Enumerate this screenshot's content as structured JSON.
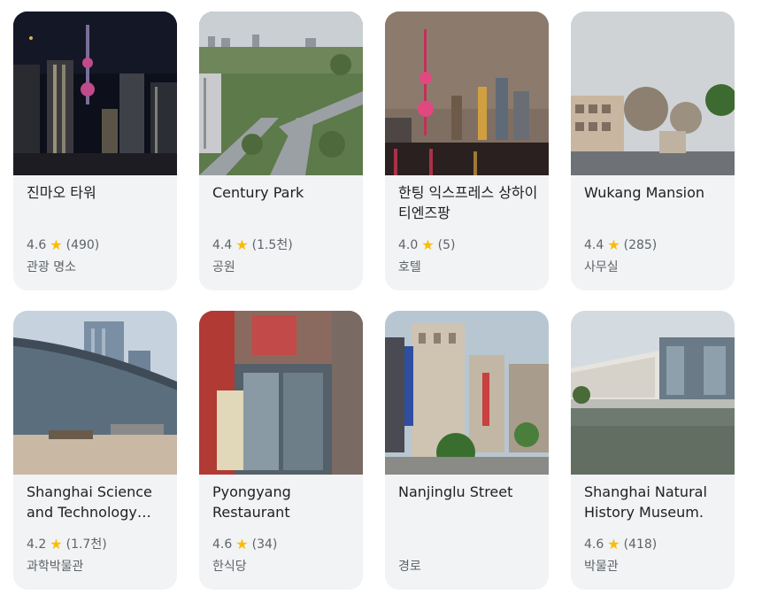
{
  "places": [
    {
      "title": "진마오 타워",
      "rating": "4.6",
      "reviews": "(490)",
      "category": "관광 명소",
      "image": "night-skyline-photo"
    },
    {
      "title": "Century Park",
      "rating": "4.4",
      "reviews": "(1.5천)",
      "category": "공원",
      "image": "park-aerial-photo"
    },
    {
      "title": "한팅 익스프레스 상하이 티엔즈팡",
      "rating": "4.0",
      "reviews": "(5)",
      "category": "호텔",
      "image": "tv-tower-night-photo"
    },
    {
      "title": "Wukang Mansion",
      "rating": "4.4",
      "reviews": "(285)",
      "category": "사무실",
      "image": "street-building-photo"
    },
    {
      "title": "Shanghai Science and Technology…",
      "rating": "4.2",
      "reviews": "(1.7천)",
      "category": "과학박물관",
      "image": "museum-glass-photo"
    },
    {
      "title": "Pyongyang Restaurant",
      "rating": "4.6",
      "reviews": "(34)",
      "category": "한식당",
      "image": "restaurant-facade-photo"
    },
    {
      "title": "Nanjinglu Street",
      "rating": "",
      "reviews": "",
      "category": "경로",
      "image": "shopping-street-photo"
    },
    {
      "title": "Shanghai Natural History Museum.",
      "rating": "4.6",
      "reviews": "(418)",
      "category": "박물관",
      "image": "modern-museum-photo"
    }
  ],
  "star_icon": "star-icon",
  "colors": {
    "star": "#fbbc04",
    "card_bg": "#f1f3f4",
    "title": "#202124",
    "meta": "#5f6368"
  }
}
